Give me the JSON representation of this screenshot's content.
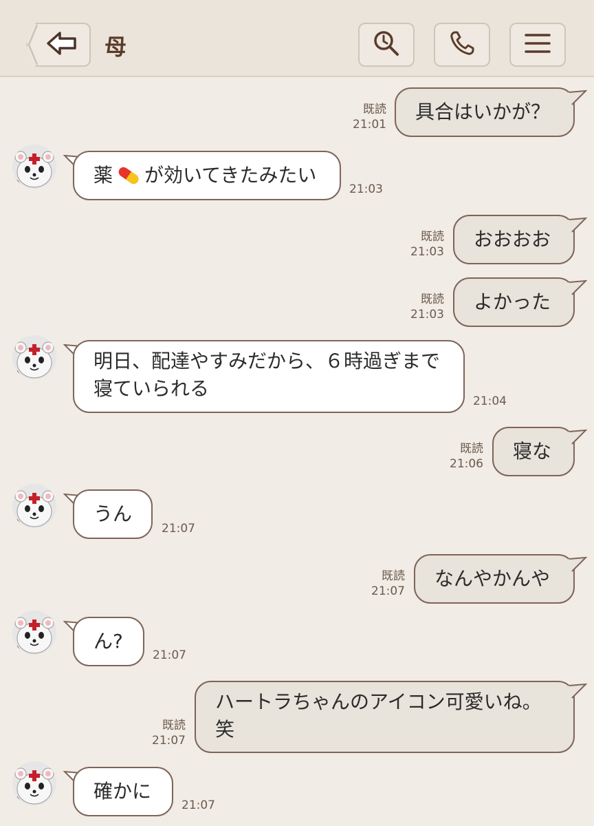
{
  "header": {
    "title": "母"
  },
  "messages": [
    {
      "dir": "out",
      "text": "具合はいかが？",
      "read": "既読",
      "time": "21:01"
    },
    {
      "dir": "in",
      "text_before": "薬",
      "emoji": "pill-emoji",
      "text_after": "が効いてきたみたい",
      "time": "21:03"
    },
    {
      "dir": "out",
      "text": "おおおお",
      "read": "既読",
      "time": "21:03"
    },
    {
      "dir": "out",
      "text": "よかった",
      "read": "既読",
      "time": "21:03"
    },
    {
      "dir": "in",
      "line1": "明日、配達やすみだから、６時過ぎまで",
      "line2": "寝ていられる",
      "time": "21:04"
    },
    {
      "dir": "out",
      "text": "寝な",
      "read": "既読",
      "time": "21:06"
    },
    {
      "dir": "in",
      "text": "うん",
      "time": "21:07"
    },
    {
      "dir": "out",
      "text": "なんやかんや",
      "read": "既読",
      "time": "21:07"
    },
    {
      "dir": "in",
      "text": "ん?",
      "time": "21:07"
    },
    {
      "dir": "out",
      "line1": "ハートラちゃんのアイコン可愛いね。",
      "line2": "笑",
      "read": "既読",
      "time": "21:07"
    },
    {
      "dir": "in",
      "text": "確かに",
      "time": "21:07"
    }
  ],
  "colors": {
    "background": "#f1ece5",
    "outgoing_bubble": "#e8e3db",
    "incoming_bubble": "#ffffff",
    "bubble_border": "#7e6459",
    "title": "#5a3b2b"
  }
}
